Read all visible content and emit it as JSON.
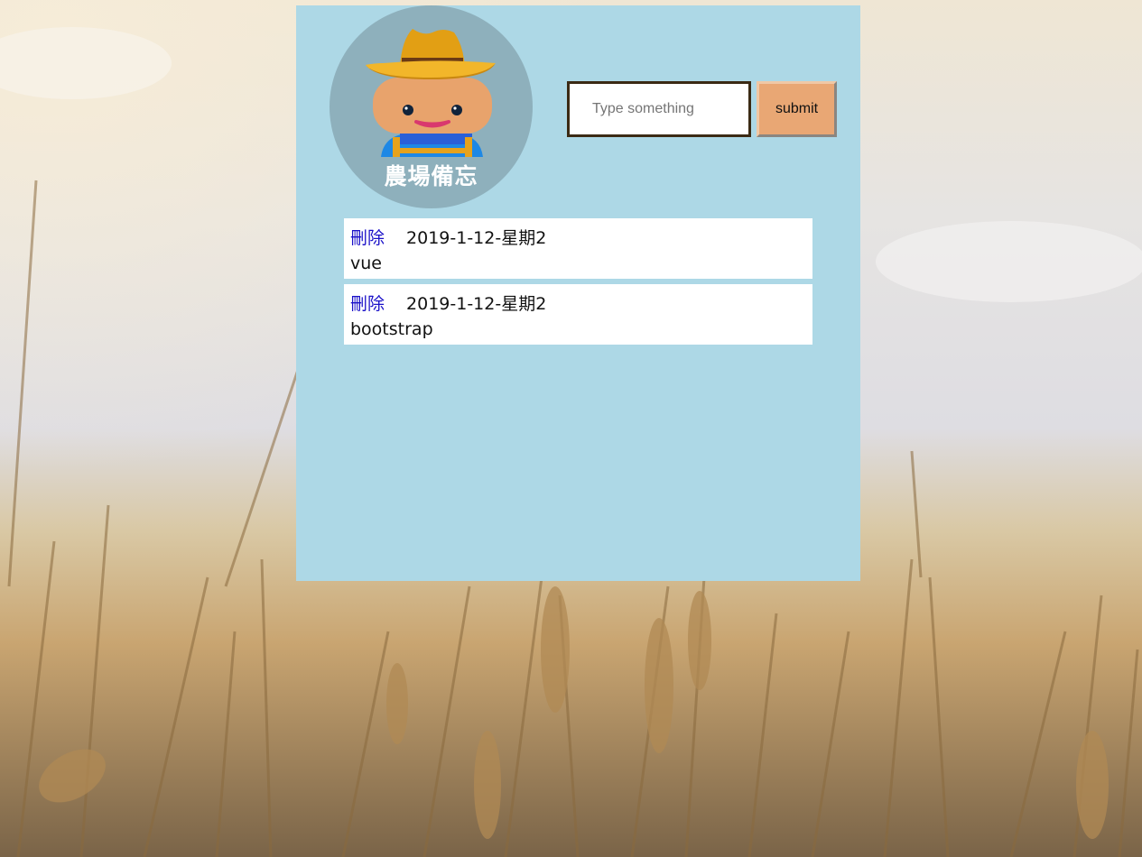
{
  "logo": {
    "title": "農場備忘",
    "icon": "farmer-avatar-icon"
  },
  "form": {
    "placeholder": "Type something",
    "value": "",
    "submit_label": "submit"
  },
  "todos": [
    {
      "delete_label": "刪除",
      "date": "2019-1-12-星期2",
      "text": "vue"
    },
    {
      "delete_label": "刪除",
      "date": "2019-1-12-星期2",
      "text": "bootstrap"
    }
  ],
  "colors": {
    "panel": "#add8e6",
    "submit": "#e9a774",
    "link": "#1a10c8",
    "logo_circle": "#8eb0bc"
  }
}
